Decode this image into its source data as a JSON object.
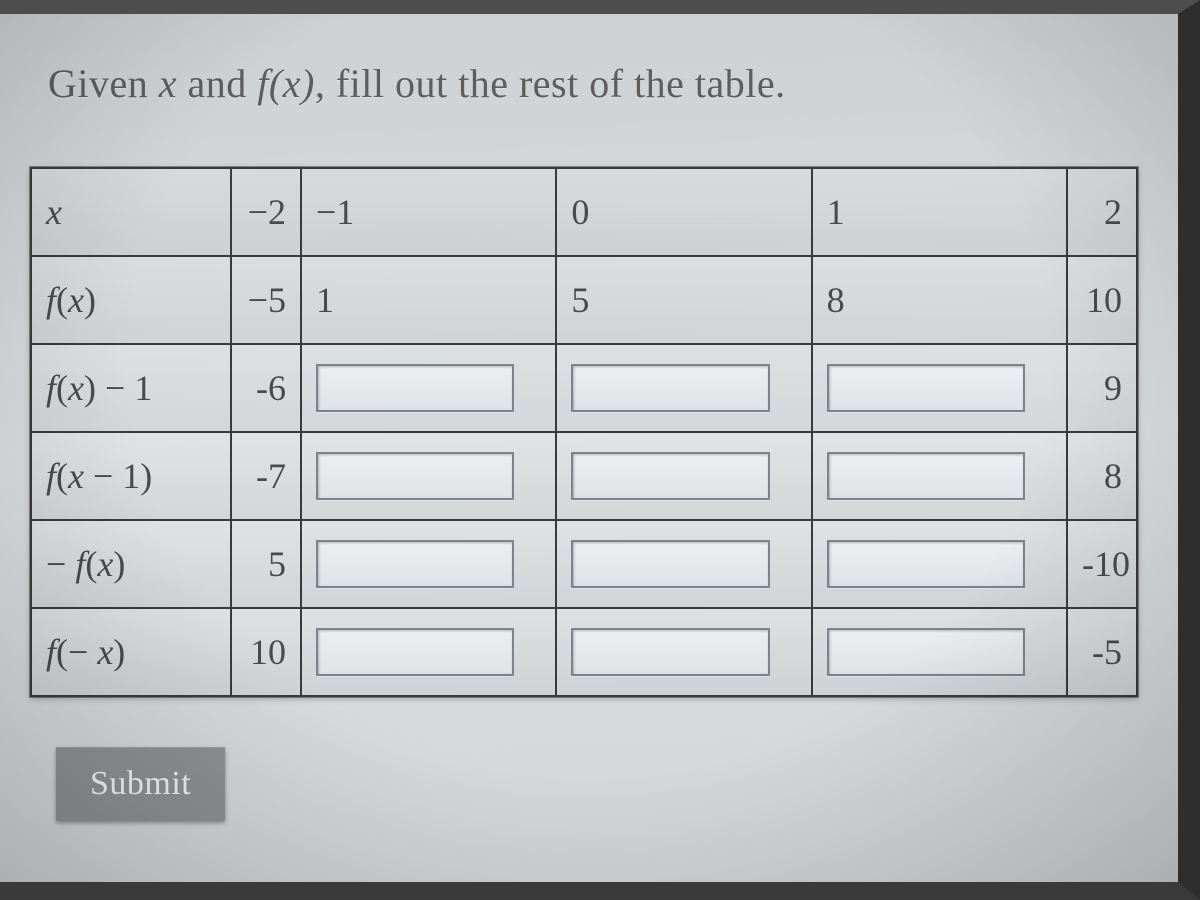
{
  "prompt": {
    "prefix": "Given ",
    "var": "x",
    "mid": " and ",
    "fn": "f(x)",
    "suffix": ", fill out the rest of the table."
  },
  "headers": {
    "x_label": "x",
    "vals": [
      "−2",
      "−1",
      "0",
      "1",
      "2"
    ]
  },
  "rows": [
    {
      "label_html": "f(x)",
      "cells": [
        {
          "type": "text",
          "value": "−5"
        },
        {
          "type": "text",
          "value": "1"
        },
        {
          "type": "text",
          "value": "5"
        },
        {
          "type": "text",
          "value": "8"
        },
        {
          "type": "text",
          "value": "10"
        }
      ]
    },
    {
      "label_html": "f(x) − 1",
      "cells": [
        {
          "type": "text",
          "value": "-6"
        },
        {
          "type": "input",
          "value": ""
        },
        {
          "type": "input",
          "value": ""
        },
        {
          "type": "input",
          "value": ""
        },
        {
          "type": "text",
          "value": "9"
        }
      ]
    },
    {
      "label_html": "f(x − 1)",
      "cells": [
        {
          "type": "text",
          "value": "-7"
        },
        {
          "type": "input",
          "value": ""
        },
        {
          "type": "input",
          "value": ""
        },
        {
          "type": "input",
          "value": ""
        },
        {
          "type": "text",
          "value": "8"
        }
      ]
    },
    {
      "label_html": "− f(x)",
      "cells": [
        {
          "type": "text",
          "value": "5"
        },
        {
          "type": "input",
          "value": ""
        },
        {
          "type": "input",
          "value": ""
        },
        {
          "type": "input",
          "value": ""
        },
        {
          "type": "text",
          "value": "-10"
        }
      ]
    },
    {
      "label_html": "f(− x)",
      "cells": [
        {
          "type": "text",
          "value": "10"
        },
        {
          "type": "input",
          "value": ""
        },
        {
          "type": "input",
          "value": ""
        },
        {
          "type": "input",
          "value": ""
        },
        {
          "type": "text",
          "value": "-5"
        }
      ]
    }
  ],
  "submit_label": "Submit"
}
